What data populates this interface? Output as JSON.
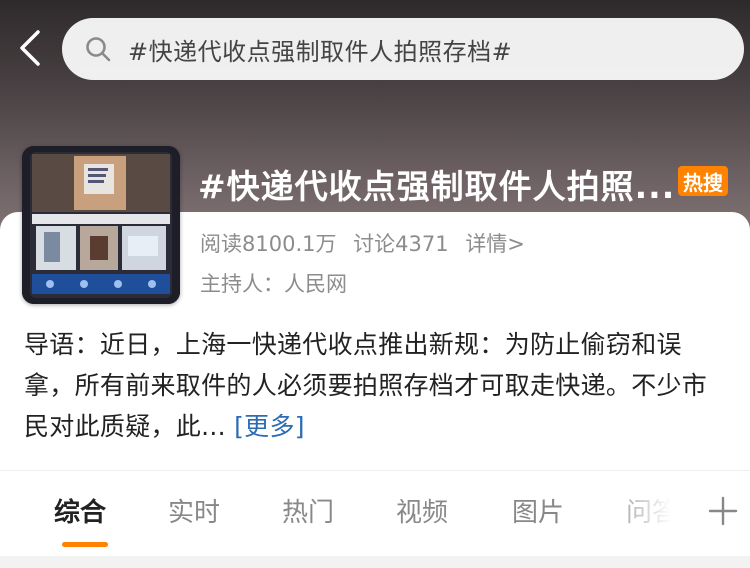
{
  "search": {
    "query": "#快递代收点强制取件人拍照存档#"
  },
  "topic": {
    "title": "#快递代收点强制取件人拍照...",
    "badge": "热搜",
    "reads": "阅读8100.1万",
    "discussions": "讨论4371",
    "details": "详情>",
    "host": "主持人：人民网"
  },
  "intro": {
    "text": "导语：近日，上海一快递代收点推出新规：为防止偷窃和误拿，所有前来取件的人必须要拍照存档才可取走快递。不少市民对此质疑，此...",
    "more": "[更多]"
  },
  "tabs": [
    {
      "label": "综合"
    },
    {
      "label": "实时"
    },
    {
      "label": "热门"
    },
    {
      "label": "视频"
    },
    {
      "label": "图片"
    },
    {
      "label": "问答"
    }
  ],
  "colors": {
    "accent": "#ff8200",
    "link": "#2b6cb4"
  },
  "icons": [
    "back-arrow-icon",
    "search-icon",
    "plus-icon"
  ]
}
